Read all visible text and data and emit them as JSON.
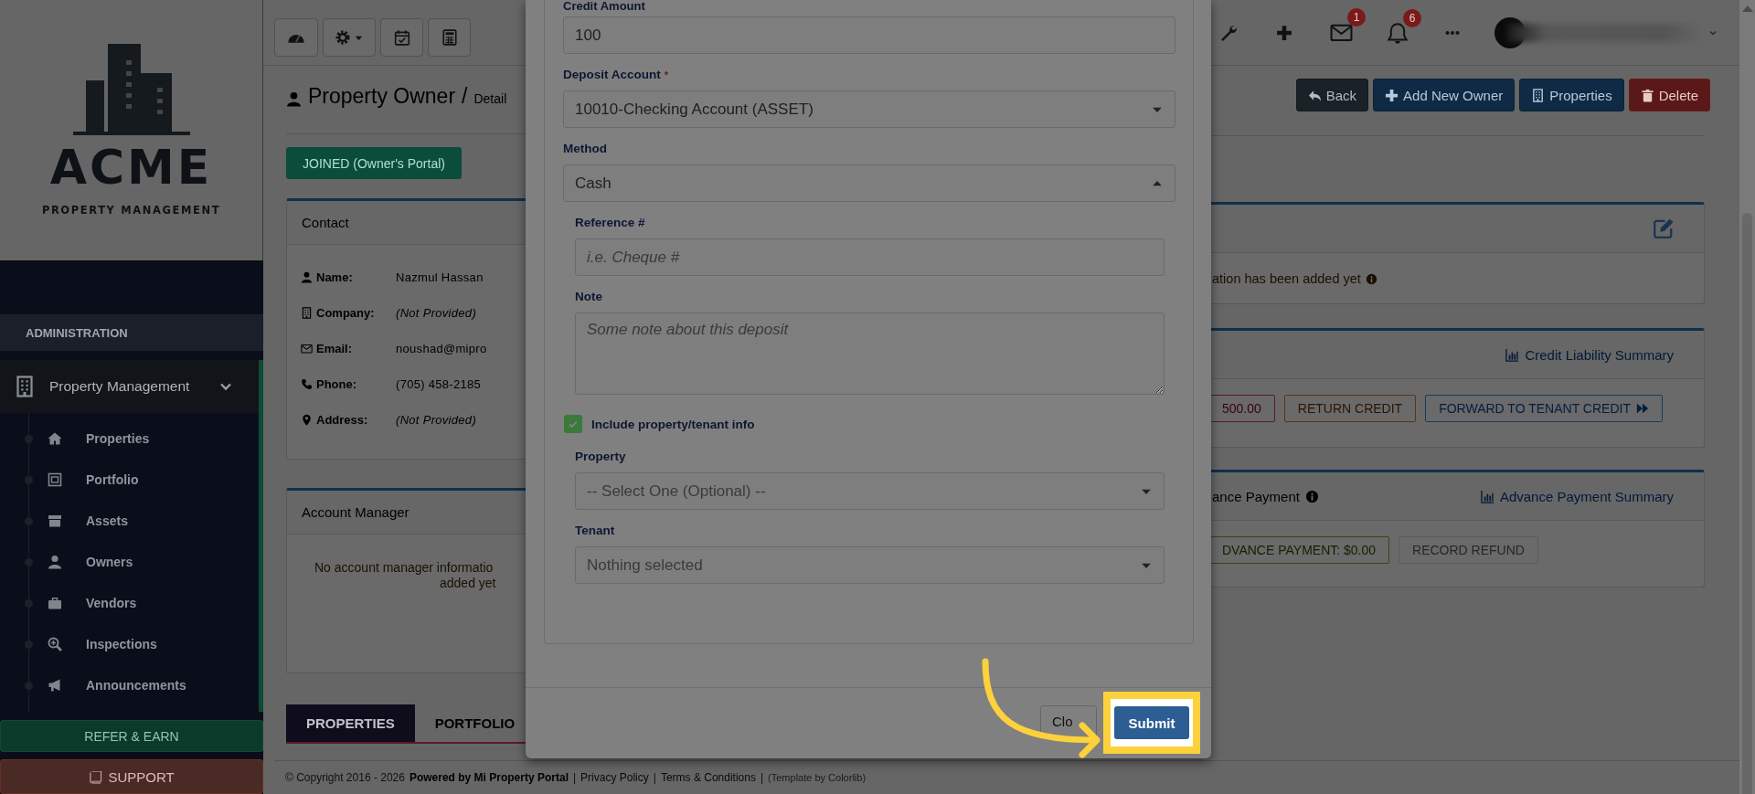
{
  "sidebar": {
    "logo": {
      "name": "ACME",
      "tagline": "PROPERTY MANAGEMENT"
    },
    "section_title": "ADMINISTRATION",
    "menu": {
      "label": "Property Management",
      "expanded": true,
      "children": [
        {
          "label": "Properties",
          "selected": false
        },
        {
          "label": "Portfolio",
          "selected": false
        },
        {
          "label": "Assets",
          "selected": false
        },
        {
          "label": "Owners",
          "selected": false
        },
        {
          "label": "Vendors",
          "selected": false
        },
        {
          "label": "Inspections",
          "selected": false
        },
        {
          "label": "Announcements",
          "selected": false
        }
      ]
    },
    "links": [
      {
        "label": "REFER & EARN",
        "kind": "refer"
      },
      {
        "label": "SUPPORT",
        "kind": "support"
      }
    ]
  },
  "top_bar": {
    "badges": [
      {
        "kind": "mail",
        "count": "1"
      },
      {
        "kind": "notifications",
        "count": "6"
      }
    ]
  },
  "page_header": {
    "title": "Property Owner",
    "separator": "/",
    "subtitle": "Detail",
    "buttons": [
      {
        "label": "Back",
        "kind": "back"
      },
      {
        "label": "Add New Owner",
        "kind": "add"
      },
      {
        "label": "Properties",
        "kind": "properties"
      },
      {
        "label": "Delete",
        "kind": "delete"
      }
    ]
  },
  "portal_status": "JOINED (Owner's Portal)",
  "contact_card": {
    "title": "Contact",
    "fields": [
      {
        "label": "Name:",
        "value": "Nazmul Hassan",
        "kind": "value"
      },
      {
        "label": "Company:",
        "value": "(Not Provided)",
        "kind": "missing"
      },
      {
        "label": "Email:",
        "value": "noushad@mipro",
        "kind": "value"
      },
      {
        "label": "Phone:",
        "value": "(705) 458-2185",
        "kind": "value"
      },
      {
        "label": "Address:",
        "value": "(Not Provided)",
        "kind": "missing"
      }
    ]
  },
  "account_manager_card": {
    "title": "Account Manager",
    "message_lines": [
      "No account manager informatio",
      "added yet"
    ]
  },
  "tabs": [
    {
      "label": "PROPERTIES",
      "selected": true
    },
    {
      "label": "PORTFOLIO",
      "selected": false
    }
  ],
  "info_card": {
    "message": "ation has been added yet"
  },
  "credit_card": {
    "link": "Credit Liability Summary",
    "buttons": [
      {
        "label": "500.00",
        "kind": "danger"
      },
      {
        "label": "RETURN CREDIT",
        "kind": "warning"
      },
      {
        "label": "FORWARD TO TENANT CREDIT",
        "kind": "forward"
      }
    ]
  },
  "advance_card": {
    "title": "ance Payment",
    "link": "Advance Payment Summary",
    "buttons": [
      {
        "label": "DVANCE PAYMENT: $0.00",
        "kind": "success"
      },
      {
        "label": "RECORD REFUND",
        "kind": "disabled"
      }
    ]
  },
  "modal": {
    "fields": [
      {
        "kind": "input",
        "label": "Credit Amount",
        "value": "100",
        "indented": false
      },
      {
        "kind": "select",
        "label": "Deposit Account",
        "required_mark": "*",
        "value": "10010-Checking Account (ASSET)",
        "expanded": false,
        "indented": false
      },
      {
        "kind": "select",
        "label": "Method",
        "value": "Cash",
        "expanded": true,
        "indented": false
      },
      {
        "kind": "input",
        "label": "Reference #",
        "placeholder": "i.e. Cheque #",
        "indented": true
      },
      {
        "kind": "textarea",
        "label": "Note",
        "placeholder": "Some note about this deposit",
        "indented": true
      },
      {
        "kind": "checkbox",
        "label": "Include property/tenant info",
        "checked": true,
        "indented": false
      },
      {
        "kind": "select",
        "label": "Property",
        "placeholder": "-- Select One (Optional) --",
        "expanded": false,
        "indented": true
      },
      {
        "kind": "select",
        "label": "Tenant",
        "placeholder": "Nothing selected",
        "expanded": false,
        "indented": true
      }
    ],
    "buttons": [
      {
        "label": "Clo",
        "kind": "default",
        "highlighted": false
      },
      {
        "label": "Submit",
        "kind": "primary",
        "highlighted": true
      }
    ]
  },
  "footer": {
    "parts": [
      {
        "text": "© Copyright 2016 - 2026",
        "kind": "text"
      },
      {
        "text": "Powered by Mi Property Portal",
        "kind": "strong"
      },
      {
        "text": "|",
        "kind": "separator"
      },
      {
        "text": "Privacy Policy",
        "kind": "link"
      },
      {
        "text": "|",
        "kind": "separator"
      },
      {
        "text": "Terms & Conditions",
        "kind": "link"
      },
      {
        "text": "|",
        "kind": "separator"
      },
      {
        "text": "(Template by Colorlib)",
        "kind": "small"
      }
    ]
  }
}
